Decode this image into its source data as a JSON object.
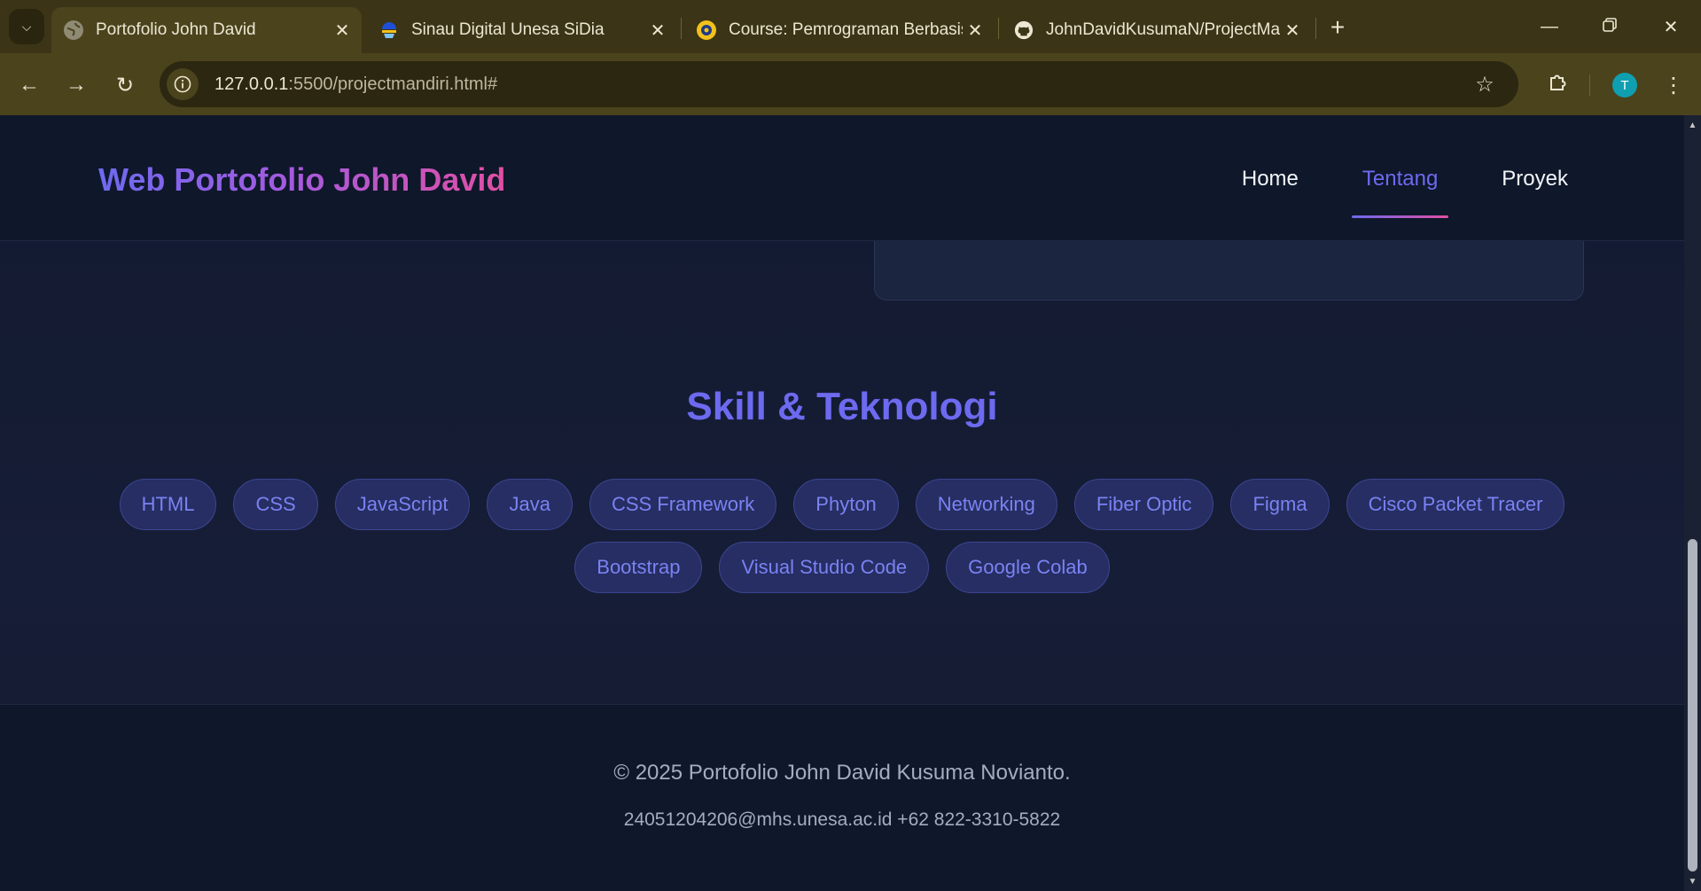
{
  "browser": {
    "tabs": [
      {
        "title": "Portofolio John David",
        "icon": "globe-icon",
        "active": true
      },
      {
        "title": "Sinau Digital Unesa SiDia",
        "icon": "sidia-icon",
        "active": false
      },
      {
        "title": "Course: Pemrograman Berbasis",
        "icon": "unesa-icon",
        "active": false
      },
      {
        "title": "JohnDavidKusumaN/ProjectMa",
        "icon": "github-icon",
        "active": false
      }
    ],
    "url_host": "127.0.0.1",
    "url_rest": ":5500/projectmandiri.html#",
    "profile_initial": "T"
  },
  "site": {
    "brand": "Web Portofolio John David",
    "nav": [
      "Home",
      "Tentang",
      "Proyek"
    ],
    "active_nav": "Tentang"
  },
  "skills": {
    "title": "Skill & Teknologi",
    "row1": [
      "HTML",
      "CSS",
      "JavaScript",
      "Java",
      "CSS Framework",
      "Phyton",
      "Networking",
      "Fiber Optic",
      "Figma",
      "Cisco Packet Tracer"
    ],
    "row2": [
      "Bootstrap",
      "Visual Studio Code",
      "Google Colab"
    ]
  },
  "footer": {
    "copyright": "© 2025 Portofolio John David Kusuma Novianto.",
    "contact": "24051204206@mhs.unesa.ac.id +62 822-3310-5822"
  },
  "colors": {
    "accent": "#6d6af0",
    "accent_pink": "#e04fa3",
    "pill_bg": "#262e63",
    "page_bg": "#0f172a"
  }
}
